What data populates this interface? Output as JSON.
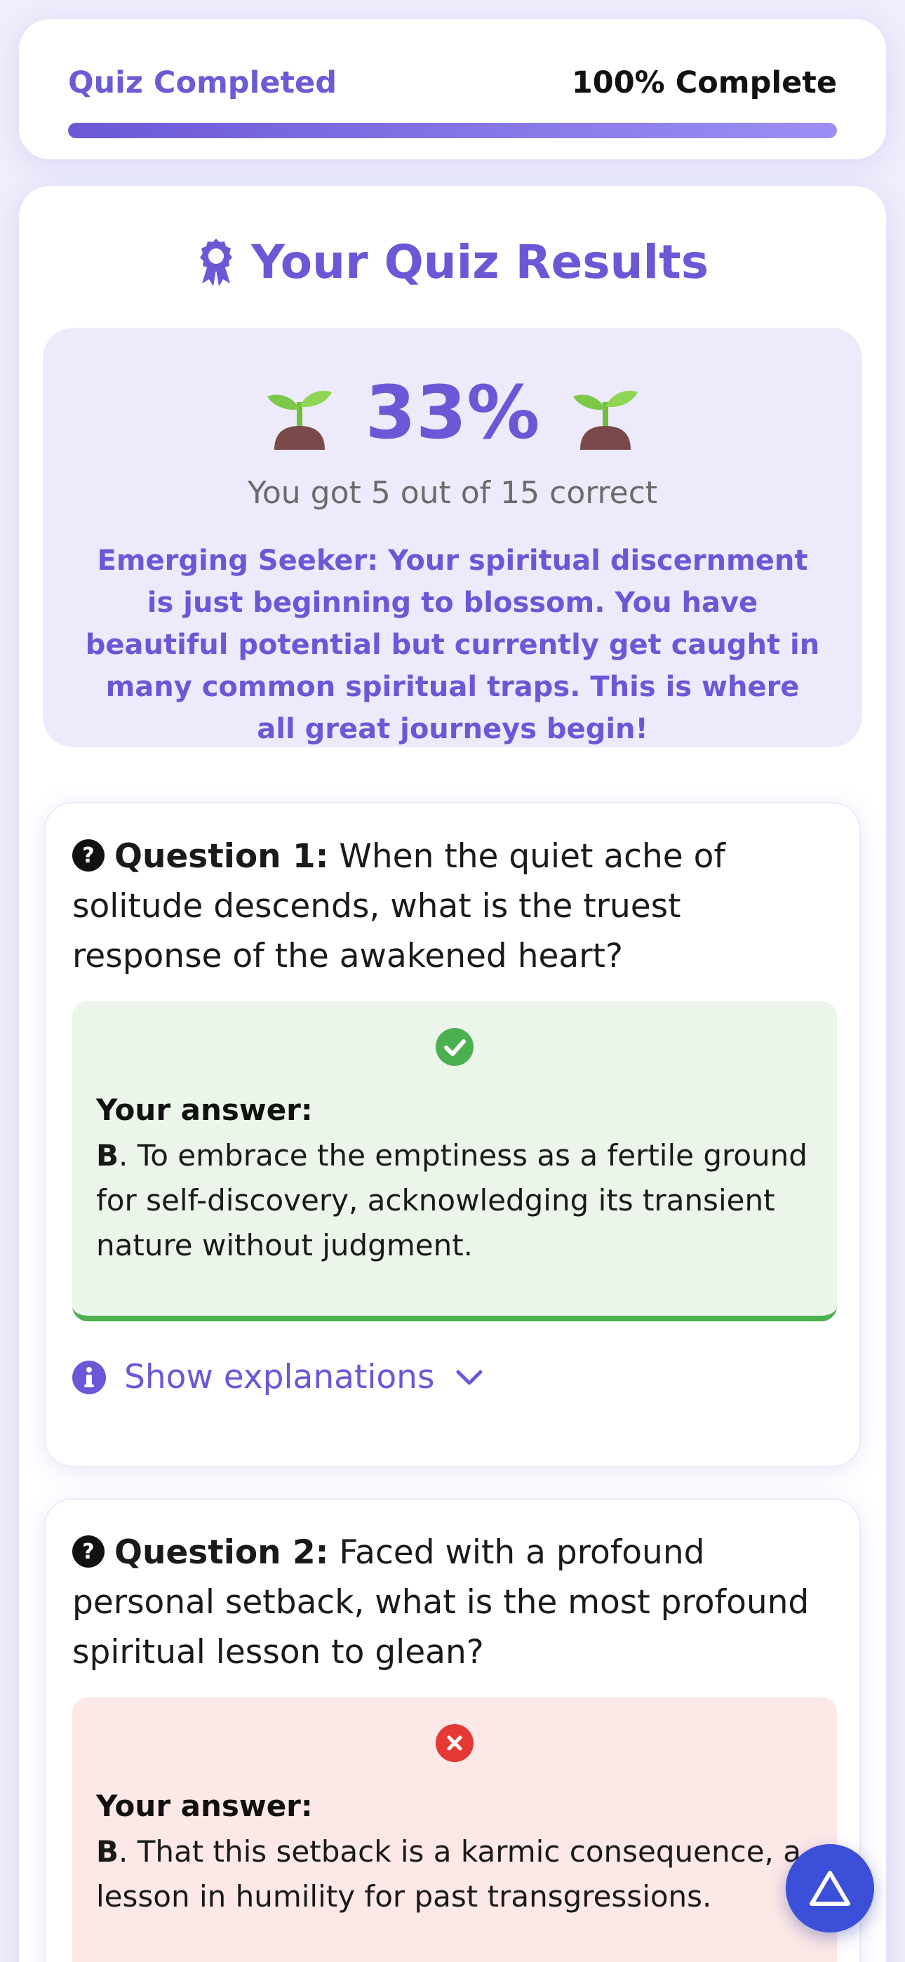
{
  "progress": {
    "status_label": "Quiz Completed",
    "percent_label": "100% Complete",
    "fraction": 1.0
  },
  "results": {
    "title": "Your Quiz Results",
    "title_icon": "award-ribbon-icon",
    "score_value": "33%",
    "score_icon": "sprout-emoji",
    "summary": "You got 5 out of 15 correct",
    "message": "Emerging Seeker: Your spiritual discernment is just beginning to blossom. You have beautiful potential but currently get caught in many common spiritual traps. This is where all great journeys begin!"
  },
  "questions": [
    {
      "label": "Question 1:",
      "text": "When the quiet ache of solitude descends, what is the truest response of the awakened heart?",
      "status": "correct",
      "answer_label": "Your answer:",
      "answer_letter": "B",
      "answer_text": ". To embrace the emptiness as a fertile ground for self-discovery, acknowledging its transient nature without judgment.",
      "explain_label": "Show explanations"
    },
    {
      "label": "Question 2:",
      "text": "Faced with a profound personal setback, what is the most profound spiritual lesson to glean?",
      "status": "incorrect",
      "answer_label": "Your answer:",
      "answer_letter": "B",
      "answer_text": ". That this setback is a karmic consequence, a lesson in humility for past transgressions."
    }
  ],
  "colors": {
    "accent": "#6a58d6",
    "correct": "#4caf50",
    "incorrect": "#e53935",
    "fab": "#3b4fd8"
  },
  "fab": {
    "icon": "triangle-up-icon"
  }
}
